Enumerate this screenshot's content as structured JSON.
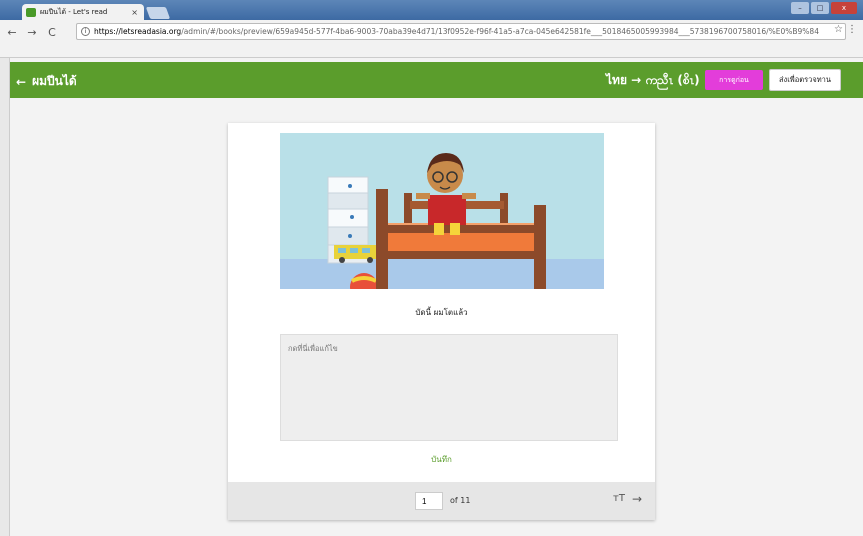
{
  "browser": {
    "tab_title": "ผมปีนได้ - Let's read",
    "tab_close": "×",
    "url_domain": "https://letsreadasia.org",
    "url_rest": "/admin/#/books/preview/659a945d-577f-4ba6-9003-70aba39e4d71/13f0952e-f96f-41a5-a7ca-045e642581fe___5018465005993984___5738196700758016/%E0%B9%84",
    "nav": {
      "back": "←",
      "forward": "→",
      "reload": "C"
    },
    "window_controls": {
      "minimize": "–",
      "maximize": "□",
      "close": "x"
    }
  },
  "header": {
    "back_arrow": "←",
    "title": "ผมปีนได้",
    "language": "ไทย → ကညီၤ (စိၤ)",
    "preview_button": "การดูก่อน",
    "submit_button": "ส่งเพื่อตรวจทาน",
    "color": "#5b9d2c"
  },
  "page": {
    "caption": "บัดนี้ ผมโตแล้ว",
    "editor_placeholder": "กดที่นี่เพื่อแก้ไข",
    "save_label": "บันทึก",
    "current_page": "1",
    "total_pages": "of 11",
    "font_icon": "тT",
    "next_icon": "→"
  }
}
